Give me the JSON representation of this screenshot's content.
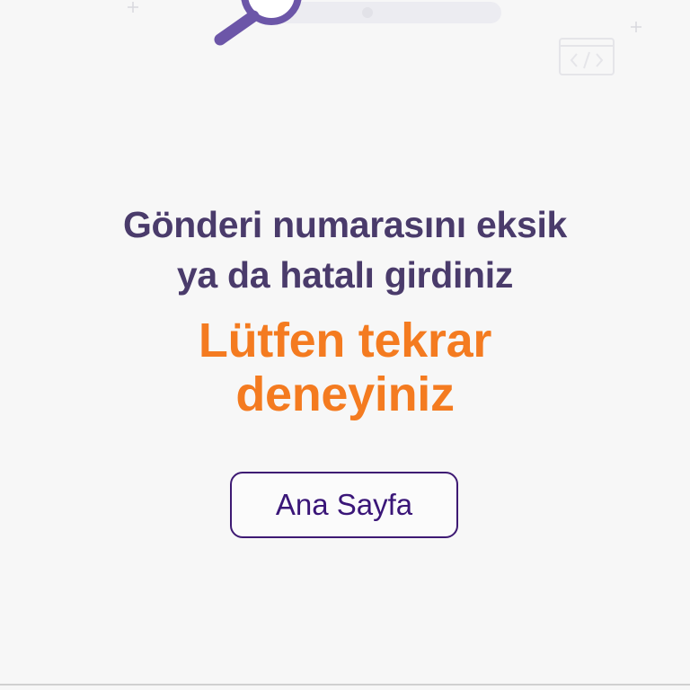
{
  "error": {
    "line1": "Gönderi numarasını eksik",
    "line2": "ya da hatalı girdiniz"
  },
  "retry": {
    "line1": "Lütfen tekrar",
    "line2": "deneyiniz"
  },
  "home_button": {
    "label": "Ana Sayfa"
  },
  "colors": {
    "error_text": "#4a3b6b",
    "retry_text": "#f47b20",
    "button_border": "#3e1a73",
    "button_text": "#3a1678",
    "background": "#f7f7f7",
    "illustration_purple": "#6c56a8"
  },
  "icons": [
    "magnifier-icon",
    "code-window-icon",
    "sparkle-icon"
  ]
}
